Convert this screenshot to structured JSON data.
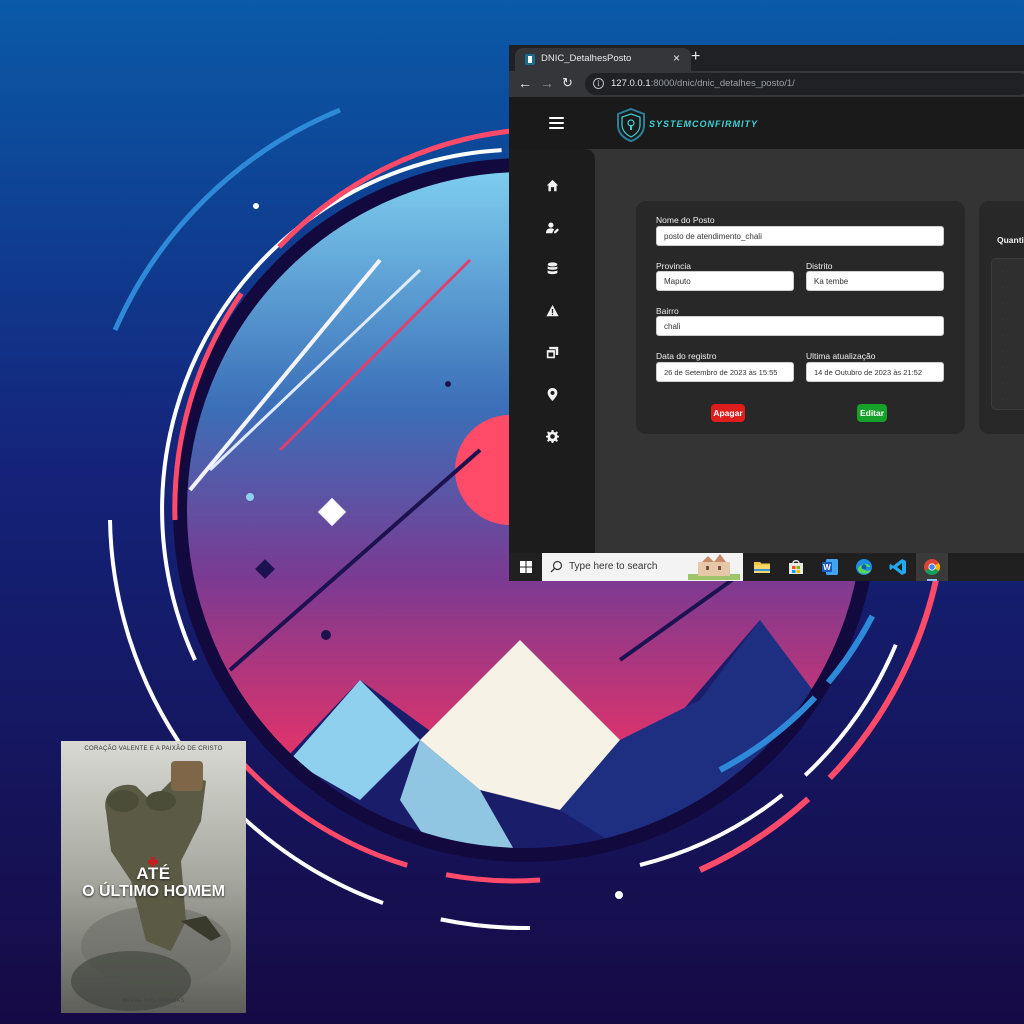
{
  "browser": {
    "tab_title": "DNIC_DetalhesPosto",
    "tab_close": "×",
    "new_tab": "+",
    "url_host": "127.0.0.1",
    "url_path": ":8000/dnic/dnic_detalhes_posto/1/"
  },
  "app": {
    "brand": "SYSTEMCONFIRMITY",
    "sidebar_icons": [
      "home-icon",
      "user-edit-icon",
      "database-icon",
      "warning-icon",
      "windows-icon",
      "map-pin-icon",
      "gear-icon"
    ]
  },
  "form": {
    "nome_label": "Nome do Posto",
    "nome_value": "posto de atendimento_chali",
    "provincia_label": "Provincia",
    "provincia_value": "Maputo",
    "distrito_label": "Distrito",
    "distrito_value": "Ka tembe",
    "bairro_label": "Bairro",
    "bairro_value": "chali",
    "data_label": "Data do registro",
    "data_value": "26 de Setembro de 2023 às 15:55",
    "atualizacao_label": "Ultima atualização",
    "atualizacao_value": "14 de Outubro de 2023 às 21:52",
    "delete_label": "Apagar",
    "edit_label": "Editar"
  },
  "side_card": {
    "title": "Quanti"
  },
  "taskbar": {
    "search_placeholder": "Type here to search",
    "pinned": [
      "file-explorer-icon",
      "microsoft-store-icon",
      "word-icon",
      "edge-icon",
      "vscode-icon",
      "chrome-icon"
    ]
  },
  "poster": {
    "tagline": "CORAÇÃO VALENTE E A PAIXÃO DE CRISTO",
    "title_line1": "ATÉ",
    "title_line2": "O ÚLTIMO HOMEM",
    "bottom": "BREVE NOS CINEMAS"
  }
}
